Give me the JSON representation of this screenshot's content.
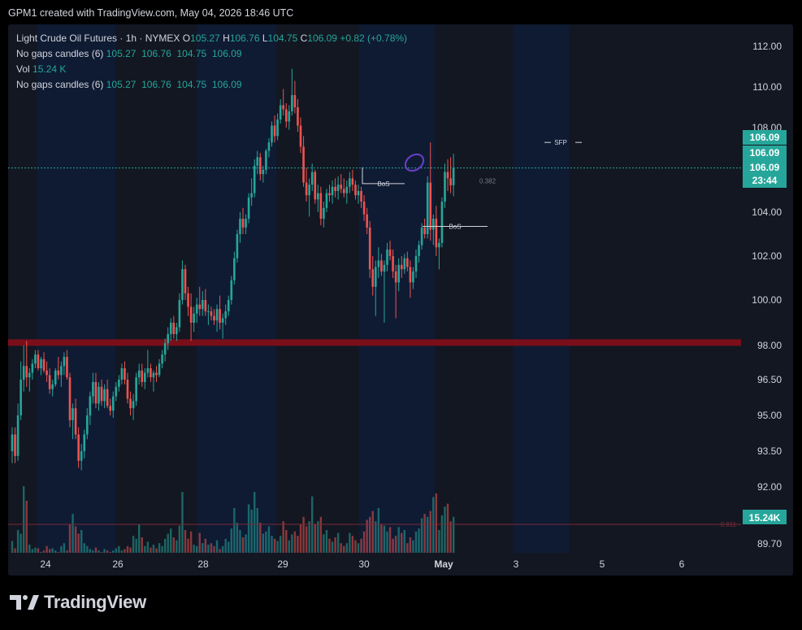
{
  "attribution": "GPM1 created with TradingView.com, May 04, 2026 18:46 UTC",
  "legend": {
    "symbol": "Light Crude Oil Futures · 1h · NYMEX",
    "o_key": "O",
    "o_val": "105.27",
    "h_key": "H",
    "h_val": "106.76",
    "l_key": "L",
    "l_val": "104.75",
    "c_key": "C",
    "c_val": "106.09",
    "change": "+0.82 (+0.78%)",
    "ind1_name": "No gaps candles (6)",
    "ind1_vals": "105.27  106.76  104.75  106.09",
    "vol_name": "Vol",
    "vol_val": "15.24 K",
    "ind2_name": "No gaps candles (6)",
    "ind2_vals": "105.27  106.76  104.75  106.09"
  },
  "logo_text": "TradingView",
  "colors": {
    "up": "#26a69a",
    "down": "#ef5350",
    "bg": "#131722",
    "band": "#0f1b33",
    "zone": "#7a0f1a",
    "accent": "#6a3fc8"
  },
  "chart_data": {
    "type": "candlestick",
    "symbol": "Light Crude Oil Futures",
    "interval": "1h",
    "y_ticks": [
      "112.00",
      "110.00",
      "108.00",
      "104.00",
      "102.00",
      "100.00",
      "98.00",
      "96.50",
      "95.00",
      "93.50",
      "92.00",
      "89.70"
    ],
    "x_ticks": [
      "24",
      "26",
      "28",
      "29",
      "30",
      "May",
      "3",
      "5",
      "6"
    ],
    "price_tags": [
      {
        "label": "106.09",
        "color": "#26a69a"
      },
      {
        "label": "106.09",
        "color": "#26a69a"
      },
      {
        "label": "106.09",
        "color": "#26a69a"
      },
      {
        "label": "23:44",
        "color": "#26a69a"
      }
    ],
    "volume_tag": "15.24K",
    "volume_level_label": "0.911",
    "current_price": 106.09,
    "support_zone": [
      97.95,
      98.2
    ],
    "annotations": [
      {
        "text": "BoS",
        "price": 105.35
      },
      {
        "text": "BoS",
        "price": 103.35
      },
      {
        "text": "0.382",
        "price": 105.25
      },
      {
        "text": "SFP",
        "price": 107.3
      }
    ],
    "candles": [
      [
        93.5,
        94.5,
        93.0,
        94.2
      ],
      [
        94.2,
        94.5,
        93.0,
        93.3
      ],
      [
        93.3,
        95.5,
        93.1,
        95.0
      ],
      [
        95.0,
        97.3,
        94.8,
        96.5
      ],
      [
        96.5,
        98.0,
        96.0,
        97.1
      ],
      [
        97.1,
        98.2,
        96.2,
        96.6
      ],
      [
        96.6,
        97.0,
        96.0,
        96.8
      ],
      [
        96.8,
        97.4,
        96.5,
        97.2
      ],
      [
        97.2,
        97.8,
        97.0,
        97.6
      ],
      [
        97.6,
        97.8,
        96.9,
        97.0
      ],
      [
        97.0,
        97.5,
        96.7,
        97.4
      ],
      [
        97.4,
        97.7,
        96.8,
        96.9
      ],
      [
        96.9,
        97.3,
        96.4,
        96.7
      ],
      [
        96.7,
        97.0,
        95.9,
        96.1
      ],
      [
        96.1,
        96.5,
        95.8,
        96.3
      ],
      [
        96.3,
        97.0,
        96.2,
        96.9
      ],
      [
        96.9,
        97.5,
        96.5,
        96.7
      ],
      [
        96.7,
        97.3,
        96.2,
        97.1
      ],
      [
        97.1,
        97.7,
        96.7,
        97.5
      ],
      [
        97.5,
        97.8,
        96.5,
        96.6
      ],
      [
        96.6,
        96.8,
        94.5,
        94.8
      ],
      [
        94.8,
        95.5,
        94.0,
        95.3
      ],
      [
        95.3,
        95.7,
        94.0,
        94.2
      ],
      [
        94.2,
        94.5,
        92.8,
        93.1
      ],
      [
        93.1,
        93.8,
        92.7,
        93.5
      ],
      [
        93.5,
        94.4,
        93.2,
        94.2
      ],
      [
        94.2,
        95.3,
        94.0,
        95.0
      ],
      [
        95.0,
        96.0,
        94.6,
        95.8
      ],
      [
        95.8,
        96.8,
        95.5,
        96.4
      ],
      [
        96.4,
        96.8,
        95.3,
        95.5
      ],
      [
        95.5,
        96.4,
        95.2,
        96.2
      ],
      [
        96.2,
        96.5,
        95.4,
        95.6
      ],
      [
        95.6,
        96.3,
        95.3,
        96.1
      ],
      [
        96.1,
        96.5,
        95.3,
        95.4
      ],
      [
        95.4,
        95.7,
        95.0,
        95.2
      ],
      [
        95.2,
        96.0,
        94.9,
        95.8
      ],
      [
        95.8,
        96.4,
        95.6,
        96.2
      ],
      [
        96.2,
        96.7,
        96.0,
        96.5
      ],
      [
        96.5,
        97.2,
        96.3,
        97.0
      ],
      [
        97.0,
        97.3,
        96.3,
        96.5
      ],
      [
        96.5,
        96.8,
        95.5,
        95.7
      ],
      [
        95.7,
        96.0,
        95.0,
        95.3
      ],
      [
        95.3,
        95.9,
        94.8,
        95.6
      ],
      [
        95.6,
        96.8,
        95.4,
        96.6
      ],
      [
        96.6,
        97.2,
        96.3,
        96.9
      ],
      [
        96.9,
        97.2,
        96.2,
        96.4
      ],
      [
        96.4,
        97.0,
        96.1,
        96.8
      ],
      [
        96.8,
        97.8,
        96.6,
        97.0
      ],
      [
        97.0,
        97.2,
        96.4,
        96.6
      ],
      [
        96.6,
        96.9,
        96.0,
        96.8
      ],
      [
        96.8,
        97.1,
        96.4,
        96.7
      ],
      [
        96.7,
        97.4,
        96.6,
        97.2
      ],
      [
        97.2,
        97.8,
        97.0,
        97.6
      ],
      [
        97.6,
        98.3,
        97.3,
        98.1
      ],
      [
        98.1,
        98.8,
        97.8,
        98.5
      ],
      [
        98.5,
        99.2,
        98.2,
        99.0
      ],
      [
        99.0,
        99.3,
        98.3,
        98.5
      ],
      [
        98.5,
        99.0,
        98.2,
        98.8
      ],
      [
        98.8,
        100.3,
        98.6,
        100.0
      ],
      [
        100.0,
        101.8,
        99.8,
        101.4
      ],
      [
        101.4,
        101.6,
        100.0,
        100.3
      ],
      [
        100.3,
        100.6,
        99.3,
        99.7
      ],
      [
        99.7,
        100.3,
        98.2,
        99.0
      ],
      [
        99.0,
        99.7,
        98.6,
        99.4
      ],
      [
        99.4,
        100.1,
        99.0,
        99.8
      ],
      [
        99.8,
        100.6,
        99.3,
        99.6
      ],
      [
        99.6,
        100.4,
        99.3,
        100.0
      ],
      [
        100.0,
        100.5,
        99.3,
        99.5
      ],
      [
        99.5,
        99.8,
        98.9,
        99.5
      ],
      [
        99.5,
        99.7,
        99.1,
        99.3
      ],
      [
        99.3,
        99.6,
        98.9,
        99.1
      ],
      [
        99.1,
        99.8,
        98.6,
        99.6
      ],
      [
        99.6,
        100.2,
        98.7,
        99.0
      ],
      [
        99.0,
        99.4,
        98.3,
        99.2
      ],
      [
        99.2,
        99.8,
        98.9,
        99.5
      ],
      [
        99.5,
        100.2,
        99.3,
        100.0
      ],
      [
        100.0,
        101.1,
        99.8,
        100.9
      ],
      [
        100.9,
        102.2,
        100.7,
        101.9
      ],
      [
        101.9,
        103.2,
        101.7,
        103.0
      ],
      [
        103.0,
        104.0,
        102.6,
        103.7
      ],
      [
        103.7,
        104.2,
        103.0,
        103.3
      ],
      [
        103.3,
        103.9,
        103.0,
        103.7
      ],
      [
        103.7,
        104.9,
        103.5,
        104.7
      ],
      [
        104.7,
        105.6,
        104.3,
        104.9
      ],
      [
        104.9,
        106.5,
        104.7,
        106.2
      ],
      [
        106.2,
        106.9,
        105.8,
        106.6
      ],
      [
        106.6,
        106.8,
        105.5,
        105.8
      ],
      [
        105.8,
        106.2,
        105.4,
        106.0
      ],
      [
        106.0,
        107.0,
        105.8,
        106.9
      ],
      [
        106.9,
        107.5,
        106.6,
        107.3
      ],
      [
        107.3,
        108.3,
        107.1,
        108.1
      ],
      [
        108.1,
        108.6,
        107.3,
        107.6
      ],
      [
        107.6,
        108.7,
        107.4,
        108.4
      ],
      [
        108.4,
        109.4,
        108.2,
        109.1
      ],
      [
        109.1,
        109.9,
        108.6,
        108.9
      ],
      [
        108.9,
        109.2,
        108.0,
        108.3
      ],
      [
        108.3,
        109.1,
        107.9,
        108.8
      ],
      [
        108.8,
        110.9,
        108.6,
        109.6
      ],
      [
        109.6,
        110.3,
        108.7,
        109.0
      ],
      [
        109.0,
        109.4,
        107.8,
        108.1
      ],
      [
        108.1,
        108.5,
        106.8,
        107.1
      ],
      [
        107.1,
        107.6,
        105.2,
        105.4
      ],
      [
        105.4,
        106.1,
        104.5,
        104.8
      ],
      [
        104.8,
        105.6,
        103.8,
        105.3
      ],
      [
        105.3,
        106.3,
        105.0,
        105.9
      ],
      [
        105.9,
        106.0,
        104.4,
        104.6
      ],
      [
        104.6,
        105.3,
        104.0,
        104.9
      ],
      [
        104.9,
        105.2,
        103.4,
        103.7
      ],
      [
        103.7,
        104.5,
        103.3,
        104.2
      ],
      [
        104.2,
        105.1,
        104.0,
        104.9
      ],
      [
        104.9,
        105.3,
        104.5,
        104.8
      ],
      [
        104.8,
        105.5,
        104.4,
        105.2
      ],
      [
        105.2,
        105.6,
        104.7,
        105.0
      ],
      [
        105.0,
        105.7,
        104.6,
        105.3
      ],
      [
        105.3,
        105.8,
        104.9,
        105.1
      ],
      [
        105.1,
        105.6,
        104.7,
        104.9
      ],
      [
        104.9,
        105.5,
        104.4,
        105.2
      ],
      [
        105.2,
        105.9,
        104.9,
        105.6
      ],
      [
        105.6,
        106.0,
        105.0,
        105.3
      ],
      [
        105.3,
        105.5,
        104.6,
        104.8
      ],
      [
        104.8,
        105.3,
        104.4,
        105.0
      ],
      [
        105.0,
        105.2,
        104.2,
        104.5
      ],
      [
        104.5,
        104.8,
        103.6,
        103.9
      ],
      [
        103.9,
        104.2,
        103.0,
        103.3
      ],
      [
        103.3,
        103.6,
        101.0,
        101.4
      ],
      [
        101.4,
        102.0,
        100.2,
        100.6
      ],
      [
        100.6,
        101.8,
        99.3,
        101.5
      ],
      [
        101.5,
        102.4,
        101.0,
        101.8
      ],
      [
        101.8,
        102.1,
        101.1,
        101.3
      ],
      [
        101.3,
        101.8,
        99.0,
        101.6
      ],
      [
        101.6,
        102.6,
        101.3,
        102.3
      ],
      [
        102.3,
        102.7,
        101.8,
        102.0
      ],
      [
        102.0,
        102.3,
        101.0,
        101.3
      ],
      [
        101.3,
        101.6,
        99.2,
        100.8
      ],
      [
        100.8,
        101.9,
        100.4,
        101.6
      ],
      [
        101.6,
        102.0,
        101.0,
        101.4
      ],
      [
        101.4,
        102.1,
        101.2,
        101.9
      ],
      [
        101.9,
        102.2,
        101.3,
        101.5
      ],
      [
        101.5,
        101.8,
        100.1,
        100.8
      ],
      [
        100.8,
        101.5,
        100.5,
        101.3
      ],
      [
        101.3,
        102.3,
        101.0,
        102.0
      ],
      [
        102.0,
        102.7,
        101.7,
        102.5
      ],
      [
        102.5,
        103.5,
        102.3,
        103.3
      ],
      [
        103.3,
        103.7,
        102.8,
        103.0
      ],
      [
        103.0,
        105.7,
        102.8,
        105.4
      ],
      [
        105.4,
        107.3,
        102.7,
        103.2
      ],
      [
        103.2,
        103.9,
        102.5,
        103.7
      ],
      [
        103.7,
        104.3,
        102.0,
        102.4
      ],
      [
        102.4,
        102.8,
        101.4,
        102.6
      ],
      [
        102.6,
        104.7,
        102.4,
        104.5
      ],
      [
        104.5,
        106.3,
        104.2,
        105.9
      ],
      [
        105.9,
        106.5,
        105.0,
        105.6
      ],
      [
        105.6,
        106.6,
        104.9,
        105.27
      ],
      [
        105.27,
        106.76,
        104.75,
        106.09
      ]
    ],
    "volumes": [
      25,
      15,
      40,
      35,
      100,
      80,
      20,
      14,
      16,
      15,
      10,
      12,
      18,
      14,
      15,
      12,
      10,
      18,
      22,
      12,
      48,
      62,
      45,
      35,
      40,
      22,
      18,
      14,
      12,
      16,
      12,
      10,
      14,
      12,
      10,
      12,
      15,
      18,
      12,
      14,
      18,
      16,
      32,
      28,
      48,
      30,
      18,
      24,
      16,
      20,
      15,
      22,
      18,
      28,
      35,
      42,
      30,
      26,
      46,
      92,
      40,
      28,
      38,
      20,
      18,
      36,
      22,
      28,
      20,
      22,
      18,
      26,
      14,
      18,
      28,
      24,
      42,
      70,
      50,
      40,
      30,
      34,
      75,
      68,
      92,
      70,
      50,
      35,
      38,
      45,
      32,
      28,
      25,
      32,
      52,
      40,
      26,
      34,
      38,
      32,
      48,
      58,
      45,
      52,
      86,
      48,
      52,
      58,
      34,
      40,
      28,
      24,
      30,
      36,
      22,
      18,
      22,
      36,
      32,
      26,
      22,
      28,
      38,
      54,
      58,
      66,
      52,
      70,
      48,
      46,
      38,
      44,
      28,
      32,
      44,
      36,
      40,
      22,
      30,
      26,
      38,
      42,
      56,
      62,
      58,
      66,
      85,
      90,
      40,
      60,
      72,
      76,
      52,
      58
    ]
  }
}
